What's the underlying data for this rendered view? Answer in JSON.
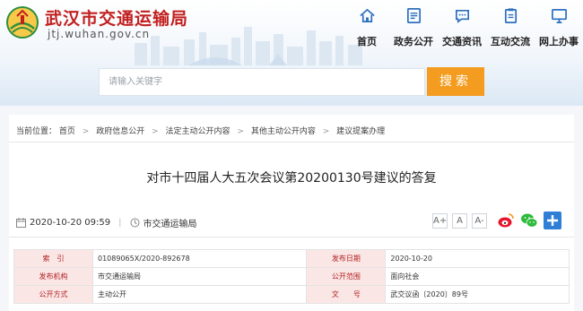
{
  "header": {
    "site_name": "武汉市交通运输局",
    "site_url": "jtj.wuhan.gov.cn",
    "nav": [
      {
        "label": "首页",
        "icon": "home-icon"
      },
      {
        "label": "政务公开",
        "icon": "document-icon"
      },
      {
        "label": "交通资讯",
        "icon": "chat-bubble-icon"
      },
      {
        "label": "互动交流",
        "icon": "clipboard-icon"
      },
      {
        "label": "网上办事",
        "icon": "computer-icon"
      }
    ],
    "search": {
      "placeholder": "请输入关键字",
      "button_label": "搜索"
    }
  },
  "breadcrumb": {
    "prefix": "当前位置：",
    "items": [
      "首页",
      "政府信息公开",
      "法定主动公开内容",
      "其他主动公开内容",
      "建议提案办理"
    ]
  },
  "document": {
    "title": "对市十四届人大五次会议第20200130号建议的答复",
    "date": "2020-10-20 09:59",
    "source": "市交通运输局",
    "font_sizes": [
      "A+",
      "A",
      "A-"
    ]
  },
  "info_table": [
    [
      "索　引",
      "01089065X/2020-892678",
      "发布日期",
      "2020-10-20"
    ],
    [
      "发布机构",
      "市交通运输局",
      "公开范围",
      "面向社会"
    ],
    [
      "公开方式",
      "主动公开",
      "文　　号",
      "武交议函〔2020〕89号"
    ]
  ],
  "colors": {
    "brand_red": "#c21f1f",
    "search_orange": "#f39c1f",
    "nav_blue": "#2c6fbf",
    "label_bg": "#fbe6e6"
  }
}
